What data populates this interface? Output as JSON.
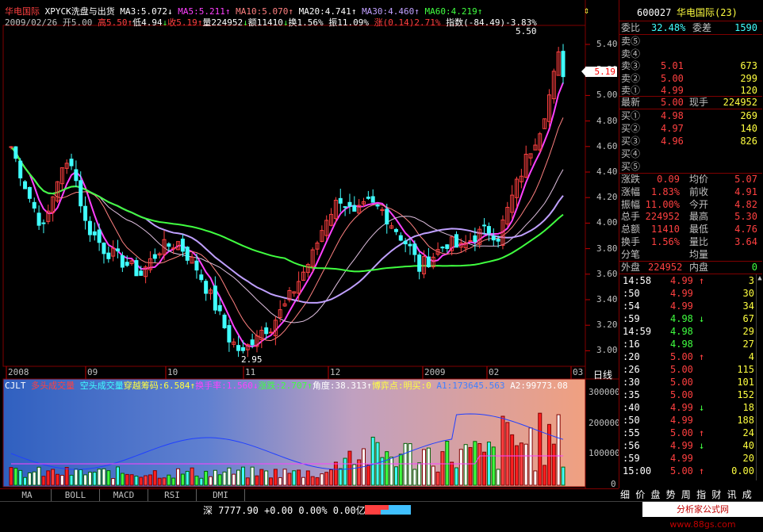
{
  "header": {
    "stock_name": "华电国际",
    "indicator_name": "XPYCK洗盘与出货",
    "ma": [
      {
        "label": "MA3:5.072",
        "arrow": "↓"
      },
      {
        "label": "MA5:5.211",
        "arrow": "↑"
      },
      {
        "label": "MA10:5.070",
        "arrow": "↑"
      },
      {
        "label": "MA20:4.741",
        "arrow": "↑"
      },
      {
        "label": "MA30:4.460",
        "arrow": "↑"
      },
      {
        "label": "MA60:4.219",
        "arrow": "↑"
      }
    ],
    "date": "2009/02/26",
    "open": "开5.00",
    "high": "高5.50",
    "low": "低4.94",
    "close": "收5.19",
    "vol": "量224952",
    "amount": "额11410",
    "turnover": "换1.56%",
    "amplitude": "振11.09%",
    "change": "涨(0.14)2.71%",
    "index": "指数(-84.49)-3.83%"
  },
  "price_axis": [
    "5.40",
    "5.20",
    "5.00",
    "4.80",
    "4.60",
    "4.40",
    "4.20",
    "4.00",
    "3.80",
    "3.60",
    "3.40",
    "3.20",
    "3.00"
  ],
  "current_price_tag": "5.19",
  "high_label": "5.50",
  "low_label": "2.95",
  "date_axis": [
    "2008",
    "09",
    "10",
    "11",
    "12",
    "2009",
    "02",
    "03"
  ],
  "period_label": "日线",
  "lower_header": {
    "name": "CJLT",
    "bull": "多头成交量",
    "bear": "空头成交量",
    "chip": "穿越筹码:6.584",
    "turnover": "换手率:1.560",
    "rise": "涨跌:2.707",
    "angle": "角度:38.313",
    "game": "博弈点:明买:0",
    "a1": "A1:173645.563",
    "a2": "A2:99773.08"
  },
  "vol_axis": [
    "300000",
    "200000",
    "100000",
    "0"
  ],
  "tabs": [
    "MA",
    "BOLL",
    "MACD",
    "RSI",
    "DMI"
  ],
  "right_panel": {
    "code": "600027",
    "name": "华电国际(23)",
    "weibi_label": "委比",
    "weibi_value": "32.48%",
    "weicha_label": "委差",
    "weicha_value": "1590",
    "asks": [
      {
        "label": "卖⑤",
        "price": "",
        "vol": ""
      },
      {
        "label": "卖④",
        "price": "",
        "vol": ""
      },
      {
        "label": "卖③",
        "price": "5.01",
        "vol": "673"
      },
      {
        "label": "卖②",
        "price": "5.00",
        "vol": "299"
      },
      {
        "label": "卖①",
        "price": "4.99",
        "vol": "120"
      }
    ],
    "latest_label": "最新",
    "latest_value": "5.00",
    "xianshou_label": "现手",
    "xianshou_value": "224952",
    "bids": [
      {
        "label": "买①",
        "price": "4.98",
        "vol": "269"
      },
      {
        "label": "买②",
        "price": "4.97",
        "vol": "140"
      },
      {
        "label": "买③",
        "price": "4.96",
        "vol": "826"
      },
      {
        "label": "买④",
        "price": "",
        "vol": ""
      },
      {
        "label": "买⑤",
        "price": "",
        "vol": ""
      }
    ],
    "stats": [
      {
        "l1": "涨跌",
        "v1": "0.09",
        "l2": "均价",
        "v2": "5.07"
      },
      {
        "l1": "涨幅",
        "v1": "1.83%",
        "l2": "前收",
        "v2": "4.91"
      },
      {
        "l1": "振幅",
        "v1": "11.00%",
        "l2": "今开",
        "v2": "4.82"
      },
      {
        "l1": "总手",
        "v1": "224952",
        "l2": "最高",
        "v2": "5.30"
      },
      {
        "l1": "总额",
        "v1": "11410",
        "l2": "最低",
        "v2": "4.76"
      },
      {
        "l1": "换手",
        "v1": "1.56%",
        "l2": "量比",
        "v2": "3.64"
      },
      {
        "l1": "分笔",
        "v1": "",
        "l2": "均量",
        "v2": ""
      }
    ],
    "waipan_label": "外盘",
    "waipan_value": "224952",
    "neipan_label": "内盘",
    "neipan_value": "0",
    "ticks": [
      {
        "t": "14:58",
        "p": "4.99",
        "a": "↑",
        "v": "3"
      },
      {
        "t": ":50",
        "p": "4.99",
        "a": "",
        "v": "30"
      },
      {
        "t": ":54",
        "p": "4.99",
        "a": "",
        "v": "34"
      },
      {
        "t": ":59",
        "p": "4.98",
        "a": "↓",
        "v": "67"
      },
      {
        "t": "14:59",
        "p": "4.98",
        "a": "",
        "v": "29"
      },
      {
        "t": ":16",
        "p": "4.98",
        "a": "",
        "v": "27"
      },
      {
        "t": ":20",
        "p": "5.00",
        "a": "↑",
        "v": "4"
      },
      {
        "t": ":26",
        "p": "5.00",
        "a": "",
        "v": "115"
      },
      {
        "t": ":30",
        "p": "5.00",
        "a": "",
        "v": "101"
      },
      {
        "t": ":35",
        "p": "5.00",
        "a": "",
        "v": "152"
      },
      {
        "t": ":40",
        "p": "4.99",
        "a": "↓",
        "v": "18"
      },
      {
        "t": ":50",
        "p": "4.99",
        "a": "",
        "v": "188"
      },
      {
        "t": ":55",
        "p": "5.00",
        "a": "↑",
        "v": "24"
      },
      {
        "t": ":56",
        "p": "4.99",
        "a": "↓",
        "v": "40"
      },
      {
        "t": ":59",
        "p": "4.99",
        "a": "",
        "v": "20"
      },
      {
        "t": "15:00",
        "p": "5.00",
        "a": "↑",
        "v": "0.00"
      }
    ],
    "bottom_tabs": "细 价 盘 势 周 指 财 讯 成 特 解"
  },
  "status": {
    "index_name": "深",
    "index_value": "7777.90",
    "index_change": "+0.00",
    "index_pct": "0.00%",
    "index_amount": "0.00亿",
    "watermark": "分析家公式网 www.88gs.com"
  },
  "colors": {
    "up": "#ff4040",
    "down": "#40ffff",
    "ma5": "#ff40ff",
    "ma30": "#c0a0ff",
    "ma60": "#40ff40"
  }
}
